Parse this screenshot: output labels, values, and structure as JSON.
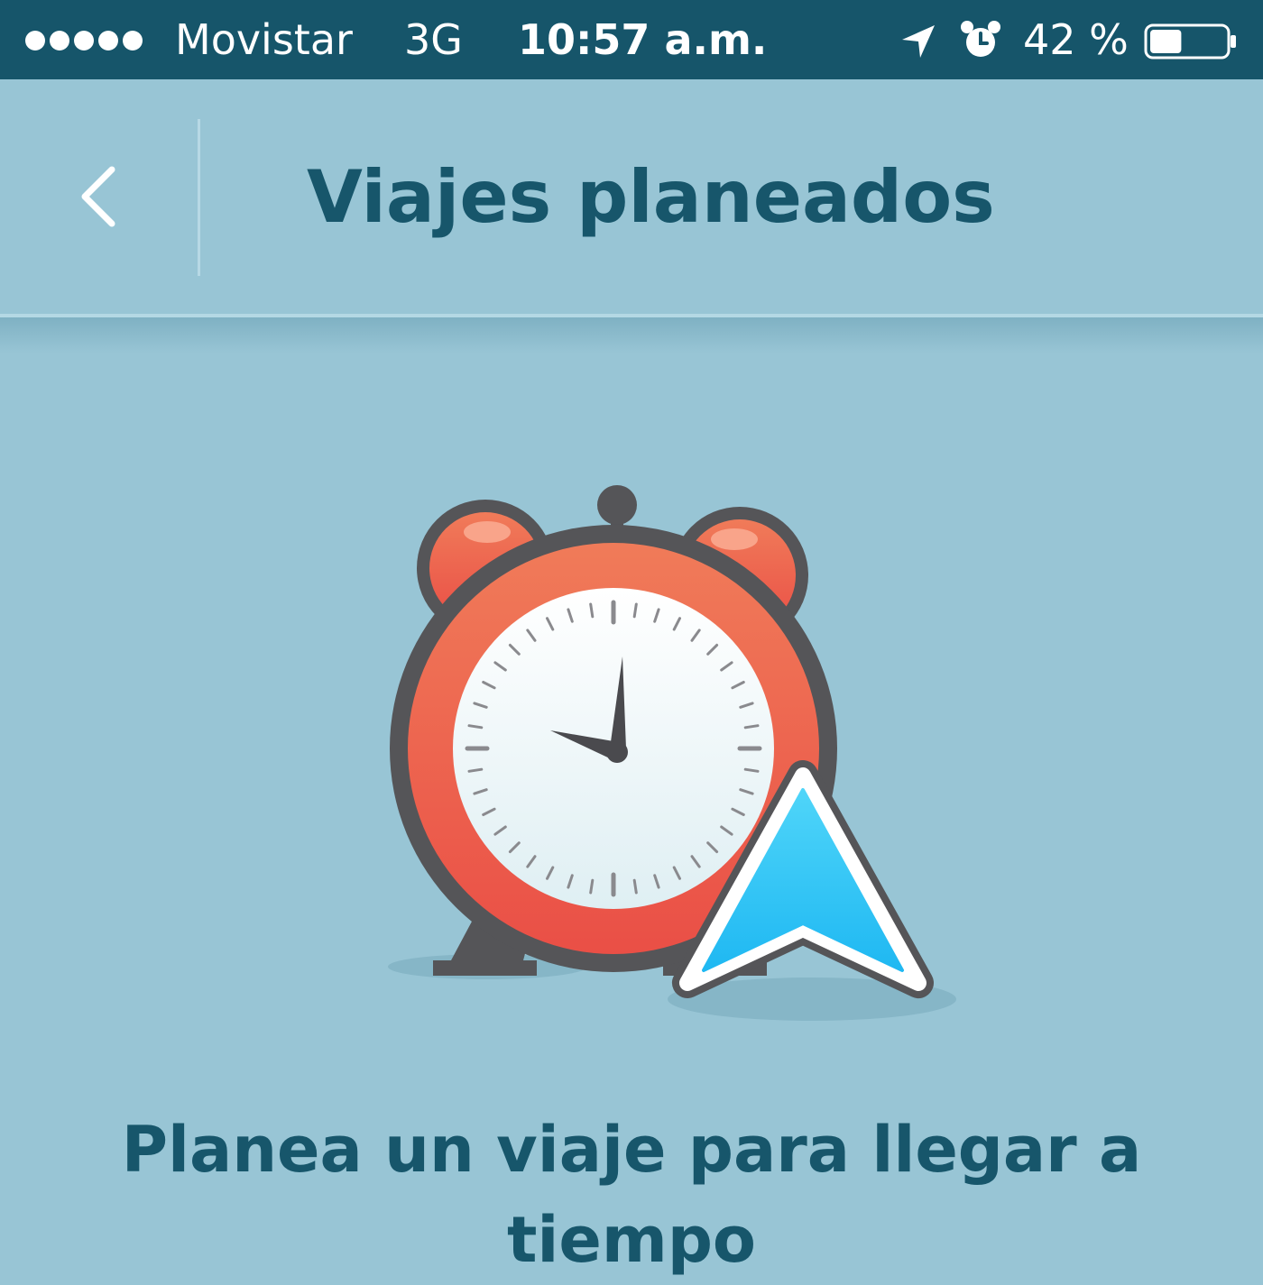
{
  "status_bar": {
    "carrier": "Movistar",
    "network": "3G",
    "time": "10:57 a.m.",
    "battery_percent": "42 %",
    "battery_level": 0.42,
    "icons": [
      "signal-dots-icon",
      "location-arrow-icon",
      "alarm-icon",
      "battery-icon"
    ]
  },
  "nav": {
    "title": "Viajes planeados",
    "back_icon": "chevron-left-icon"
  },
  "main": {
    "illustration_icon": "alarm-clock-with-navigation-arrow-icon",
    "headline": "Planea un viaje para llegar a tiempo"
  },
  "colors": {
    "status_bar_bg": "#16556a",
    "background": "#98c5d5",
    "title_text": "#17566b",
    "clock_red": "#ee5b4b",
    "arrow_blue": "#2bc7f6"
  }
}
